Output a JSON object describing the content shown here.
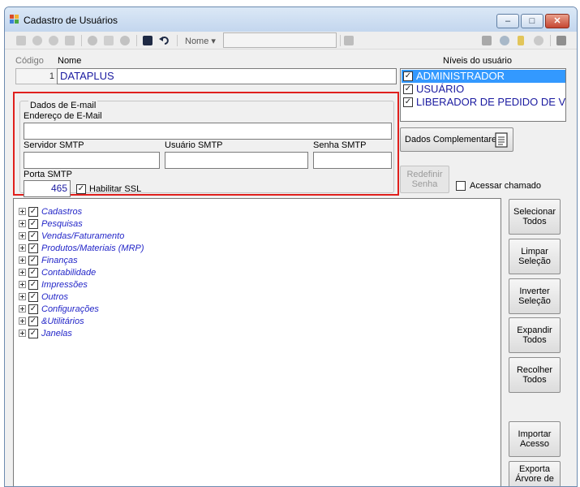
{
  "window": {
    "title": "Cadastro de Usuários",
    "minimize": "–",
    "maximize": "□",
    "close": "✕"
  },
  "toolbar": {
    "field_label": "Nome ▾",
    "search_value": ""
  },
  "form": {
    "codigo_label": "Código",
    "codigo_value": "1",
    "nome_label": "Nome",
    "nome_value": "DATAPLUS"
  },
  "levels": {
    "label": "Níveis do usuário",
    "items": [
      {
        "label": "ADMINISTRADOR",
        "checked": true,
        "selected": true
      },
      {
        "label": "USUÁRIO",
        "checked": true,
        "selected": false
      },
      {
        "label": "LIBERADOR DE PEDIDO DE VENDA",
        "checked": true,
        "selected": false
      }
    ]
  },
  "email": {
    "group_title": "Dados de E-mail",
    "address_label": "Endereço de E-Mail",
    "address_value": "",
    "smtp_server_label": "Servidor SMTP",
    "smtp_server_value": "",
    "smtp_user_label": "Usuário SMTP",
    "smtp_user_value": "",
    "smtp_password_label": "Senha SMTP",
    "smtp_password_value": "",
    "smtp_port_label": "Porta SMTP",
    "smtp_port_value": "465",
    "ssl_label": "Habilitar SSL",
    "ssl_checked": true
  },
  "actions": {
    "complementary_label": "Dados Complementares",
    "reset_password_line1": "Redefinir",
    "reset_password_line2": "Senha",
    "access_called_label": "Acessar chamado",
    "access_called_checked": false
  },
  "tree": {
    "items": [
      {
        "label": "Cadastros",
        "checked": true
      },
      {
        "label": "Pesquisas",
        "checked": true
      },
      {
        "label": "Vendas/Faturamento",
        "checked": true
      },
      {
        "label": "Produtos/Materiais (MRP)",
        "checked": true
      },
      {
        "label": "Finanças",
        "checked": true
      },
      {
        "label": "Contabilidade",
        "checked": true
      },
      {
        "label": "Impressões",
        "checked": true
      },
      {
        "label": "Outros",
        "checked": true
      },
      {
        "label": "Configurações",
        "checked": true
      },
      {
        "label": "&Utilitários",
        "checked": true
      },
      {
        "label": "Janelas",
        "checked": true
      }
    ]
  },
  "side_buttons": [
    {
      "line1": "Selecionar",
      "line2": "Todos"
    },
    {
      "line1": "Limpar",
      "line2": "Seleção"
    },
    {
      "line1": "Inverter",
      "line2": "Seleção"
    },
    {
      "line1": "Expandir",
      "line2": "Todos"
    },
    {
      "line1": "Recolher",
      "line2": "Todos"
    },
    {
      "line1": "Importar",
      "line2": "Acesso"
    },
    {
      "line1": "Exporta",
      "line2": "Árvore de"
    }
  ],
  "colors": {
    "highlight_border": "#e0201d",
    "selection": "#3399ff",
    "tree_text": "#2326c8"
  }
}
